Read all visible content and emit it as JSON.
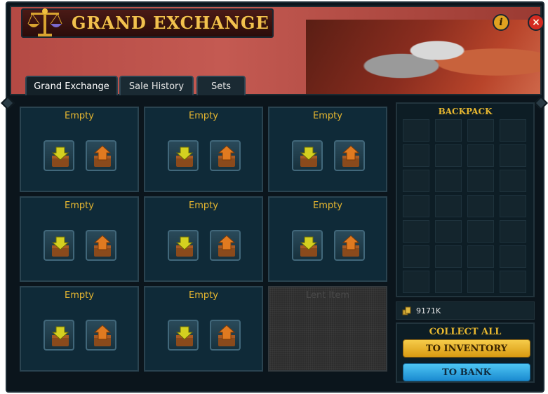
{
  "window": {
    "title": "GRAND EXCHANGE",
    "info_label": "i",
    "close_label": "×"
  },
  "tabs": [
    {
      "label": "Grand Exchange",
      "active": true
    },
    {
      "label": "Sale History",
      "active": false
    },
    {
      "label": "Sets",
      "active": false
    }
  ],
  "slots": [
    {
      "label": "Empty"
    },
    {
      "label": "Empty"
    },
    {
      "label": "Empty"
    },
    {
      "label": "Empty"
    },
    {
      "label": "Empty"
    },
    {
      "label": "Empty"
    },
    {
      "label": "Empty"
    },
    {
      "label": "Empty"
    }
  ],
  "lent_item": {
    "label": "Lent Item"
  },
  "backpack": {
    "title": "BACKPACK",
    "coins": "9171K"
  },
  "collect": {
    "title": "COLLECT ALL",
    "to_inventory": "TO INVENTORY",
    "to_bank": "TO BANK"
  },
  "colors": {
    "accent_gold": "#e8b830",
    "buy_arrow": "#d4d020",
    "sell_arrow": "#e07a20",
    "bank_button": "#1a8ad0",
    "inventory_button": "#d89a12"
  }
}
